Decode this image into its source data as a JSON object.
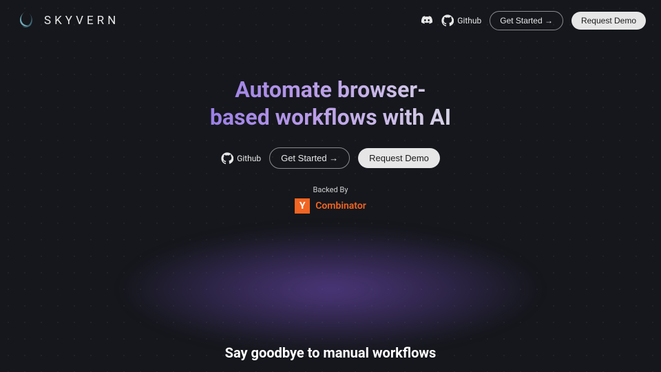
{
  "brand": {
    "name": "SKYVERN"
  },
  "header": {
    "github_label": "Github",
    "get_started_label": "Get Started →",
    "request_demo_label": "Request Demo"
  },
  "hero": {
    "title_line1": "Automate browser-",
    "title_line2": "based workflows with AI",
    "github_label": "Github",
    "get_started_label": "Get Started →",
    "request_demo_label": "Request Demo"
  },
  "backed": {
    "label": "Backed By",
    "yc_letter": "Y",
    "yc_text": "Combinator"
  },
  "subheading": "Say goodbye to manual workflows"
}
